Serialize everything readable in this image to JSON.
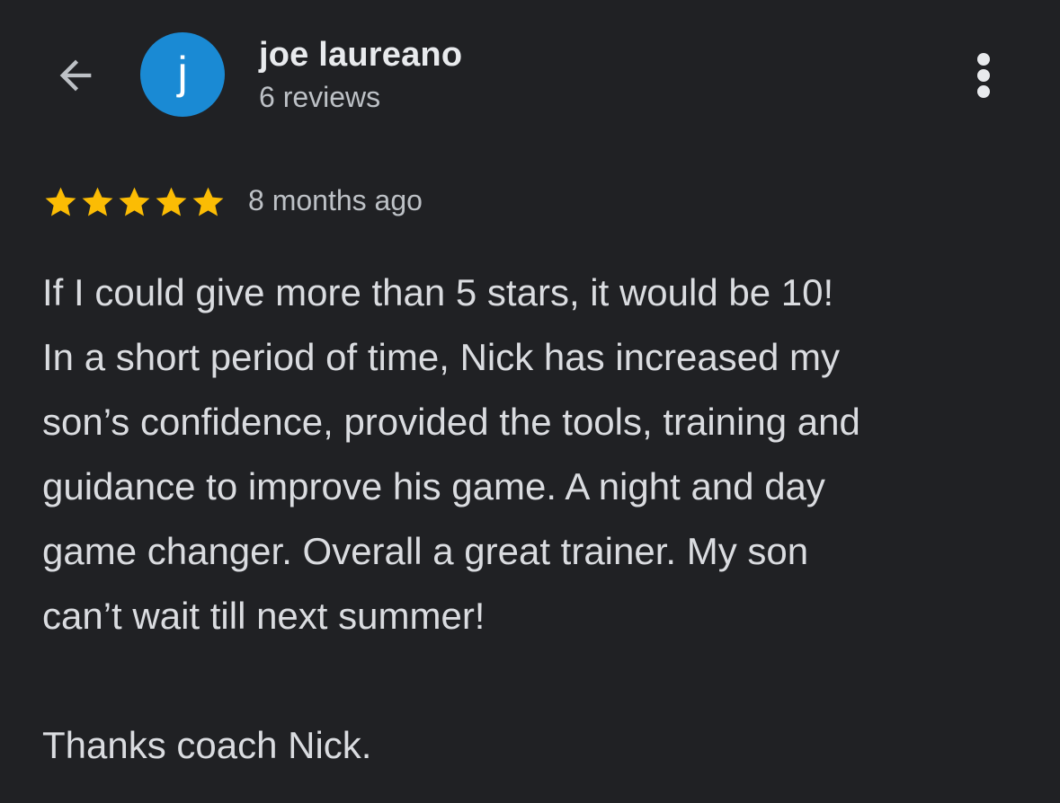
{
  "reviewer": {
    "name": "joe laureano",
    "review_count": "6 reviews",
    "avatar_letter": "j",
    "avatar_color": "#1a8ad4"
  },
  "review": {
    "rating": 5,
    "rating_max": 5,
    "star_color": "#fbbc04",
    "date": "8 months ago",
    "text": "If I could give more than 5 stars, it would be 10!\nIn a short period of time, Nick has increased my\nson’s confidence, provided the tools, training and\nguidance to improve his game. A night and day\ngame changer. Overall a great trainer. My son\ncan’t wait till next summer!\n\nThanks coach Nick."
  },
  "icons": {
    "back": "arrow-back-icon",
    "more": "more-vert-icon",
    "star": "star-icon"
  },
  "theme": {
    "background": "#202124",
    "text_primary": "#e8eaed",
    "text_secondary": "#bdc1c6"
  }
}
